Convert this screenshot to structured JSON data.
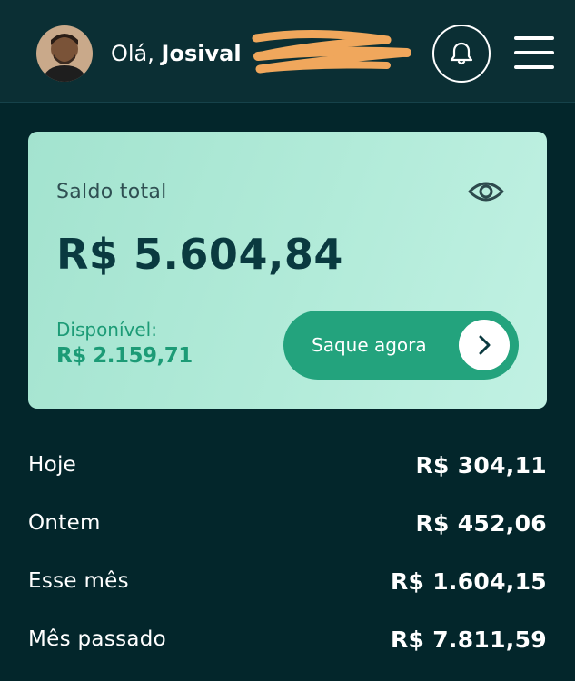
{
  "header": {
    "greeting_prefix": "Olá,",
    "user_name": "Josival"
  },
  "balance_card": {
    "label": "Saldo total",
    "total": "R$ 5.604,84",
    "available_label": "Disponível:",
    "available_value": "R$ 2.159,71",
    "withdraw_label": "Saque agora"
  },
  "summary": [
    {
      "label": "Hoje",
      "value": "R$ 304,11"
    },
    {
      "label": "Ontem",
      "value": "R$ 452,06"
    },
    {
      "label": "Esse mês",
      "value": "R$ 1.604,15"
    },
    {
      "label": "Mês passado",
      "value": "R$ 7.811,59"
    }
  ],
  "icons": {
    "notifications": "bell-icon",
    "menu": "hamburger-menu-icon",
    "visibility": "eye-icon",
    "withdraw_arrow": "chevron-right-icon"
  },
  "colors": {
    "background": "#03262b",
    "header_background": "#0b2f34",
    "card_gradient_start": "#a3e3cf",
    "card_gradient_end": "#c1f1e3",
    "accent_green": "#23a37d",
    "available_text": "#1c9b76",
    "balance_text": "#0a3a40"
  }
}
